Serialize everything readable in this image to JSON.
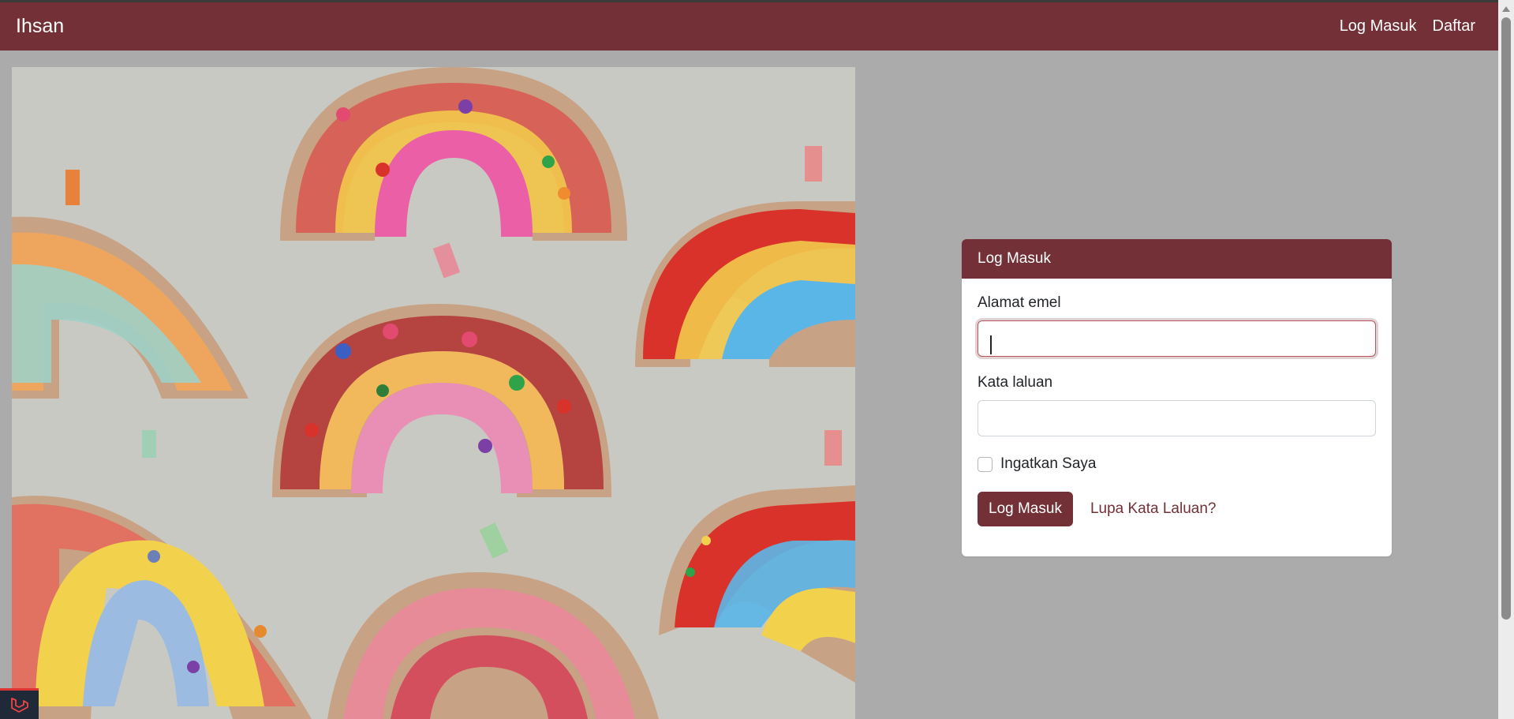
{
  "navbar": {
    "brand": "Ihsan",
    "links": [
      "Log Masuk",
      "Daftar"
    ]
  },
  "login_card": {
    "title": "Log Masuk",
    "email_label": "Alamat emel",
    "email_value": "",
    "password_label": "Kata laluan",
    "password_value": "",
    "remember_label": "Ingatkan Saya",
    "remember_checked": false,
    "submit_label": "Log Masuk",
    "forgot_label": "Lupa Kata Laluan?"
  },
  "colors": {
    "primary": "#733036",
    "page_bg": "#ababab",
    "card_bg": "#ffffff"
  },
  "hero_image": {
    "subject": "rainbow-collage-crafts"
  },
  "icons": {
    "laravel_badge": "laravel-logo-icon",
    "scroll_up": "scroll-up-arrow-icon"
  }
}
